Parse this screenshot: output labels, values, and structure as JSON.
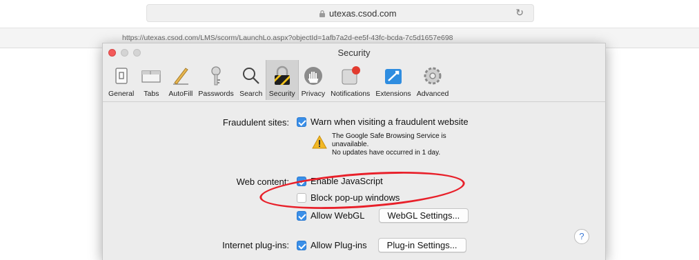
{
  "browser": {
    "domain": "utexas.csod.com",
    "full_url": "https://utexas.csod.com/LMS/scorm/LaunchLo.aspx?objectId=1afb7a2d-ee5f-43fc-bcda-7c5d1657e698"
  },
  "window": {
    "title": "Security"
  },
  "toolbar": {
    "items": [
      {
        "label": "General",
        "icon": "general-icon"
      },
      {
        "label": "Tabs",
        "icon": "tabs-icon"
      },
      {
        "label": "AutoFill",
        "icon": "autofill-icon"
      },
      {
        "label": "Passwords",
        "icon": "passwords-icon"
      },
      {
        "label": "Search",
        "icon": "search-icon"
      },
      {
        "label": "Security",
        "icon": "security-icon",
        "active": true
      },
      {
        "label": "Privacy",
        "icon": "privacy-icon"
      },
      {
        "label": "Notifications",
        "icon": "notifications-icon"
      },
      {
        "label": "Extensions",
        "icon": "extensions-icon"
      },
      {
        "label": "Advanced",
        "icon": "advanced-icon"
      }
    ]
  },
  "fraudulent": {
    "label": "Fraudulent sites:",
    "checkbox_label": "Warn when visiting a fraudulent website",
    "checked": true,
    "warning_line1": "The Google Safe Browsing Service is",
    "warning_line2": "unavailable.",
    "warning_line3": "No updates have occurred in 1 day."
  },
  "web_content": {
    "label": "Web content:",
    "javascript_label": "Enable JavaScript",
    "javascript_checked": true,
    "popups_label": "Block pop-up windows",
    "popups_checked": false,
    "webgl_label": "Allow WebGL",
    "webgl_checked": true,
    "webgl_button": "WebGL Settings..."
  },
  "plugins": {
    "label": "Internet plug-ins:",
    "checkbox_label": "Allow Plug-ins",
    "checked": true,
    "button": "Plug-in Settings..."
  },
  "help": {
    "label": "?"
  },
  "colors": {
    "accent": "#3a8fe8",
    "highlight_ellipse": "#e8202a",
    "window_bg": "#ececec"
  }
}
